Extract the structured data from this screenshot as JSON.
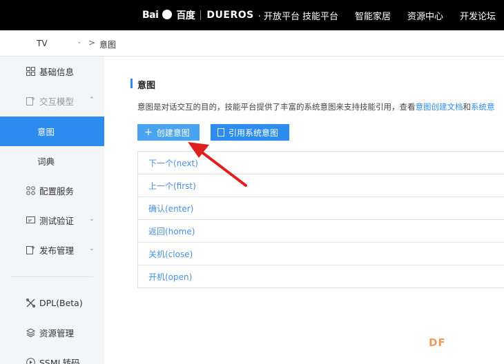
{
  "header": {
    "brand_bai": "Bai",
    "brand_du": "百度",
    "brand_dueros": "DUER",
    "brand_os": "OS",
    "brand_sub": "· 开放平台",
    "nav": [
      "技能平台",
      "智能家居",
      "资源中心",
      "开发论坛"
    ]
  },
  "breadcrumb": {
    "device": "TV",
    "separator": ">",
    "current": "意图"
  },
  "sidebar": {
    "items": [
      {
        "label": "基础信息",
        "icon": "grid-icon"
      },
      {
        "label": "交互模型",
        "icon": "edit-plus-icon",
        "expanded": true
      },
      {
        "label": "意图",
        "active": true
      },
      {
        "label": "词典"
      },
      {
        "label": "配置服务",
        "icon": "cluster-icon"
      },
      {
        "label": "测试验证",
        "icon": "monitor-icon"
      },
      {
        "label": "发布管理",
        "icon": "edit-plus-icon"
      },
      {
        "label": "DPL(Beta)",
        "icon": "tools-icon"
      },
      {
        "label": "资源管理",
        "icon": "layers-icon"
      },
      {
        "label": "SSML转码",
        "icon": "play-circle-icon"
      }
    ]
  },
  "main": {
    "title": "意图",
    "description_prefix": "意图是对话交互的目的，技能平台提供了丰富的系统意图来支持技能引用，查看",
    "description_link1": "意图创建文档",
    "description_and": "和",
    "description_link2": "系统意",
    "create_button": "创建意图",
    "reference_button": "引用系统意图",
    "intents": [
      "下一个(next)",
      "上一个(first)",
      "确认(enter)",
      "返回(home)",
      "关机(close)",
      "开机(open)"
    ]
  },
  "colors": {
    "accent": "#2d8cf0",
    "annotation_arrow": "#e02020",
    "watermark": "#f39b5a"
  },
  "watermark": "DF"
}
